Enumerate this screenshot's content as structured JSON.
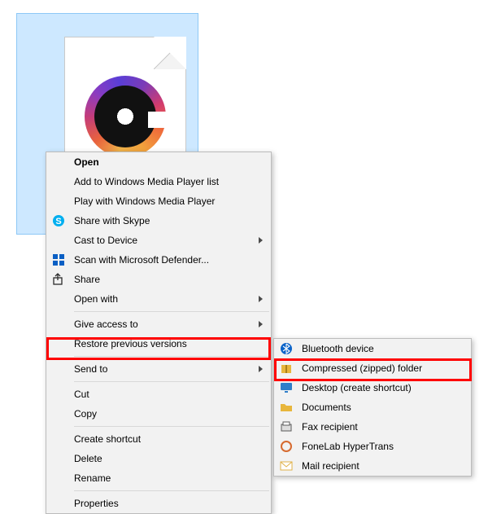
{
  "context_menu": {
    "items": [
      {
        "label": "Open",
        "bold": true
      },
      {
        "label": "Add to Windows Media Player list"
      },
      {
        "label": "Play with Windows Media Player"
      },
      {
        "label": "Share with Skype",
        "icon": "skype-icon"
      },
      {
        "label": "Cast to Device",
        "submenu": true
      },
      {
        "label": "Scan with Microsoft Defender...",
        "icon": "defender-icon"
      },
      {
        "label": "Share",
        "icon": "share-icon"
      },
      {
        "label": "Open with",
        "submenu": true
      },
      {
        "sep": true
      },
      {
        "label": "Give access to",
        "submenu": true
      },
      {
        "label": "Restore previous versions"
      },
      {
        "sep": true
      },
      {
        "label": "Send to",
        "submenu": true,
        "highlight": true
      },
      {
        "sep": true
      },
      {
        "label": "Cut"
      },
      {
        "label": "Copy"
      },
      {
        "sep": true
      },
      {
        "label": "Create shortcut"
      },
      {
        "label": "Delete"
      },
      {
        "label": "Rename"
      },
      {
        "sep": true
      },
      {
        "label": "Properties"
      }
    ]
  },
  "send_to_submenu": {
    "items": [
      {
        "label": "Bluetooth device",
        "icon": "bluetooth-icon"
      },
      {
        "label": "Compressed (zipped) folder",
        "icon": "zip-icon",
        "highlight": true
      },
      {
        "label": "Desktop (create shortcut)",
        "icon": "desktop-icon"
      },
      {
        "label": "Documents",
        "icon": "folder-icon"
      },
      {
        "label": "Fax recipient",
        "icon": "fax-icon"
      },
      {
        "label": "FoneLab HyperTrans",
        "icon": "app-icon"
      },
      {
        "label": "Mail recipient",
        "icon": "mail-icon"
      }
    ]
  },
  "icons": {
    "skype-icon": "#00aff0",
    "defender-icon": "#0a5fc4",
    "share-icon": "#2b2b2b",
    "bluetooth-icon": "#0a63c9",
    "zip-icon": "#e8b63c",
    "desktop-icon": "#2e7ec9",
    "folder-icon": "#e8b63c",
    "fax-icon": "#5a5a5a",
    "app-icon": "#d66a2f",
    "mail-icon": "#e0b24a"
  }
}
